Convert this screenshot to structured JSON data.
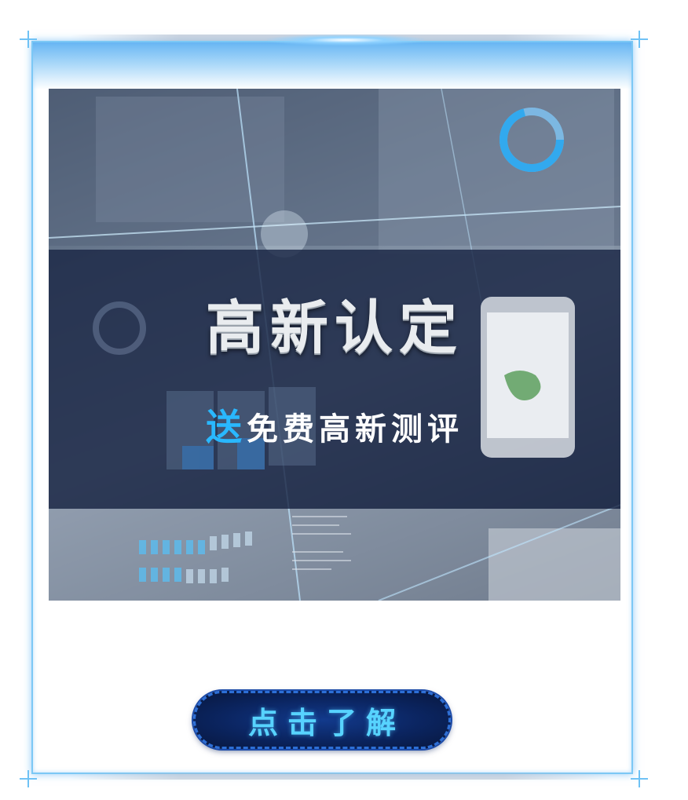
{
  "hero": {
    "title": "高新认定",
    "subtitle_accent": "送",
    "subtitle_rest": "免费高新测评"
  },
  "cta": {
    "label": "点击了解"
  },
  "colors": {
    "frame": "#7cc8f5",
    "banner": "#1a2644",
    "accent": "#29b8ff",
    "button": "#0b2561",
    "button_text": "#57d3ff"
  }
}
